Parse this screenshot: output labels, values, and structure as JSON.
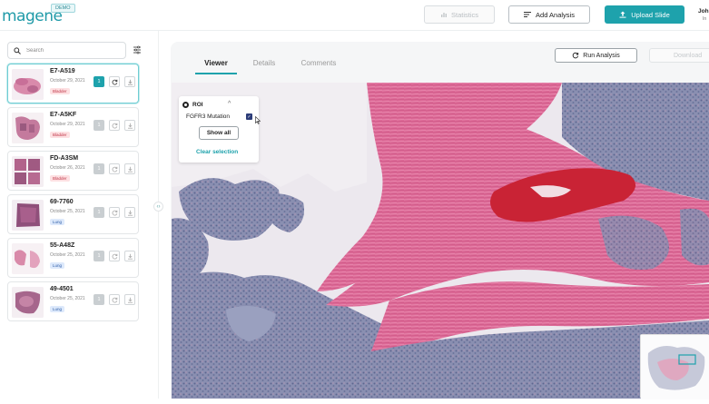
{
  "header": {
    "logo": "magene",
    "demo_badge": "DEMO",
    "statistics_label": "Statistics",
    "add_analysis_label": "Add Analysis",
    "upload_slide_label": "Upload Slide",
    "user_name": "Joh",
    "user_org": "In"
  },
  "sidebar": {
    "search_placeholder": "Search",
    "slides": [
      {
        "id": "E7-A519",
        "date": "October 29, 2021",
        "tag": "Bladder",
        "tag_type": "bladder",
        "count": "1",
        "active": true
      },
      {
        "id": "E7-A5KF",
        "date": "October 29, 2021",
        "tag": "Bladder",
        "tag_type": "bladder",
        "count": "1",
        "active": false
      },
      {
        "id": "FD-A3SM",
        "date": "October 26, 2021",
        "tag": "Bladder",
        "tag_type": "bladder",
        "count": "1",
        "active": false
      },
      {
        "id": "69-7760",
        "date": "October 25, 2021",
        "tag": "Lung",
        "tag_type": "lung",
        "count": "1",
        "active": false
      },
      {
        "id": "55-A48Z",
        "date": "October 25, 2021",
        "tag": "Lung",
        "tag_type": "lung",
        "count": "1",
        "active": false
      },
      {
        "id": "49-4501",
        "date": "October 25, 2021",
        "tag": "Lung",
        "tag_type": "lung",
        "count": "1",
        "active": false
      }
    ]
  },
  "main": {
    "tabs": [
      {
        "label": "Viewer",
        "active": true
      },
      {
        "label": "Details",
        "active": false
      },
      {
        "label": "Comments",
        "active": false
      }
    ],
    "run_analysis_label": "Run Analysis",
    "download_label": "Download"
  },
  "roi": {
    "title": "ROI",
    "item_label": "FGFR3 Mutation",
    "item_checked": true,
    "show_all_label": "Show all",
    "clear_label": "Clear selection"
  },
  "colors": {
    "accent": "#1ea2ac",
    "tissue_pink": "#d9588a",
    "tissue_blue": "#7f86a8",
    "blood_red": "#c21a2b"
  }
}
